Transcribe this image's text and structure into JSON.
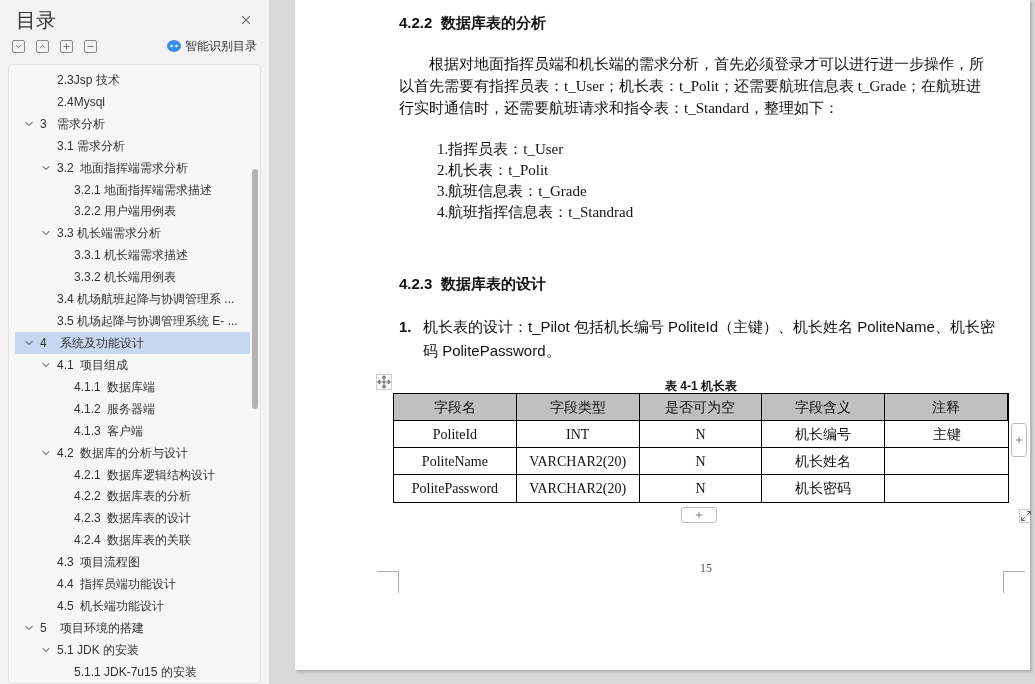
{
  "toc": {
    "title": "目录",
    "smart_button": "智能识别目录",
    "items": [
      {
        "children": [
          {
            "label": "2.3Jsp 技术",
            "selected": false
          },
          {
            "label": "2.4Mysql",
            "selected": false
          }
        ]
      },
      {
        "label": "3   需求分析",
        "expanded": true,
        "selected": false,
        "children": [
          {
            "label": "3.1 需求分析",
            "selected": false
          },
          {
            "label": "3.2  地面指挥端需求分析",
            "expanded": true,
            "selected": false,
            "children": [
              {
                "label": "3.2.1 地面指挥端需求描述",
                "selected": false
              },
              {
                "label": "3.2.2 用户端用例表",
                "selected": false
              }
            ]
          },
          {
            "label": "3.3 机长端需求分析",
            "expanded": true,
            "selected": false,
            "children": [
              {
                "label": "3.3.1 机长端需求描述",
                "selected": false
              },
              {
                "label": "3.3.2 机长端用例表",
                "selected": false
              }
            ]
          },
          {
            "label": "3.4 机场航班起降与协调管理系 ...",
            "selected": false
          },
          {
            "label": "3.5 机场起降与协调管理系统 E- ...",
            "selected": false
          }
        ]
      },
      {
        "label": "4    系统及功能设计",
        "expanded": true,
        "selected": true,
        "children": [
          {
            "label": "4.1  项目组成",
            "expanded": true,
            "selected": false,
            "children": [
              {
                "label": "4.1.1  数据库端",
                "selected": false
              },
              {
                "label": "4.1.2  服务器端",
                "selected": false
              },
              {
                "label": "4.1.3  客户端",
                "selected": false
              }
            ]
          },
          {
            "label": "4.2  数据库的分析与设计",
            "expanded": true,
            "selected": false,
            "children": [
              {
                "label": "4.2.1  数据库逻辑结构设计",
                "selected": false
              },
              {
                "label": "4.2.2  数据库表的分析",
                "selected": false
              },
              {
                "label": "4.2.3  数据库表的设计",
                "selected": false
              },
              {
                "label": "4.2.4  数据库表的关联",
                "selected": false
              }
            ]
          },
          {
            "label": "4.3  项目流程图",
            "selected": false
          },
          {
            "label": "4.4  指挥员端功能设计",
            "selected": false
          },
          {
            "label": "4.5  机长端功能设计",
            "selected": false
          }
        ]
      },
      {
        "label": "5    项目环境的搭建",
        "expanded": true,
        "selected": false,
        "children": [
          {
            "label": "5.1 JDK 的安装",
            "expanded": true,
            "selected": false,
            "children": [
              {
                "label": "5.1.1 JDK-7u15 的安装",
                "selected": false
              }
            ]
          }
        ]
      }
    ]
  },
  "document": {
    "heading_1": "4.2.2  数据库表的分析",
    "paragraph": "根据对地面指挥员端和机长端的需求分析，首先必须登录才可以进行进一步操作，所以首先需要有指挥员表：t_User；机长表：t_Polit；还需要航班信息表 t_Grade；在航班进行实时通信时，还需要航班请求和指令表：t_Standard，整理如下：",
    "list": [
      "1.指挥员表：t_User",
      "2.机长表：t_Polit",
      "3.航班信息表：t_Grade",
      "4.航班指挥信息表：t_Standrad"
    ],
    "heading_2": "4.2.3  数据库表的设计",
    "numbered_item": {
      "number": "1.",
      "text": "机长表的设计：t_Pilot 包括机长编号 PoliteId（主键）、机长姓名 PoliteName、机长密码 PolitePassword。"
    },
    "table": {
      "caption": "表 4-1  机长表",
      "columns": [
        "字段名",
        "字段类型",
        "是否可为空",
        "字段含义",
        "注释"
      ],
      "rows": [
        [
          "PoliteId",
          "INT",
          "N",
          "机长编号",
          "主键"
        ],
        [
          "PoliteName",
          "VARCHAR2(20)",
          "N",
          "机长姓名",
          ""
        ],
        [
          "PolitePassword",
          "VARCHAR2(20)",
          "N",
          "机长密码",
          ""
        ]
      ]
    },
    "page_number": "15"
  }
}
